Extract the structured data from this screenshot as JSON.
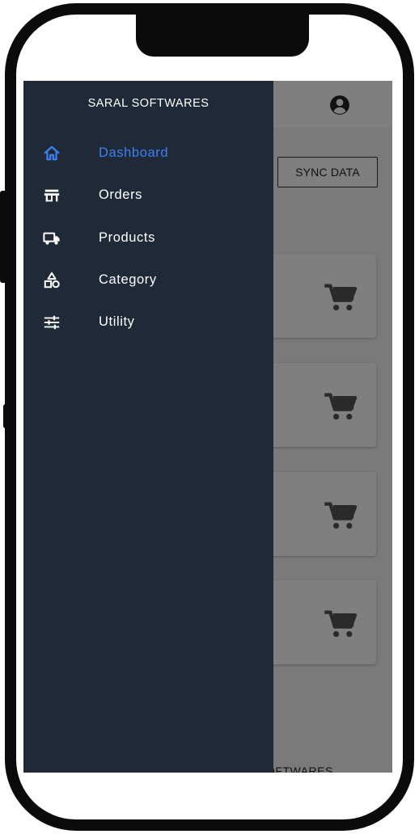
{
  "drawer": {
    "brand": "SARAL SOFTWARES",
    "items": [
      {
        "label": "Dashboard",
        "icon": "home-icon",
        "active": true
      },
      {
        "label": "Orders",
        "icon": "store-icon",
        "active": false
      },
      {
        "label": "Products",
        "icon": "truck-icon",
        "active": false
      },
      {
        "label": "Category",
        "icon": "shapes-icon",
        "active": false
      },
      {
        "label": "Utility",
        "icon": "sliders-icon",
        "active": false
      }
    ]
  },
  "header": {
    "account_icon": "account-circle-icon"
  },
  "main": {
    "sync_label": "SYNC DATA",
    "cards": [
      {
        "icon": "cart-icon"
      },
      {
        "icon": "cart-icon"
      },
      {
        "icon": "cart-icon"
      },
      {
        "icon": "cart-icon"
      }
    ],
    "footer_text": "OFTWARES"
  },
  "colors": {
    "drawer_bg": "#1f2937",
    "active": "#3b82f6",
    "text_light": "#ffffff"
  }
}
